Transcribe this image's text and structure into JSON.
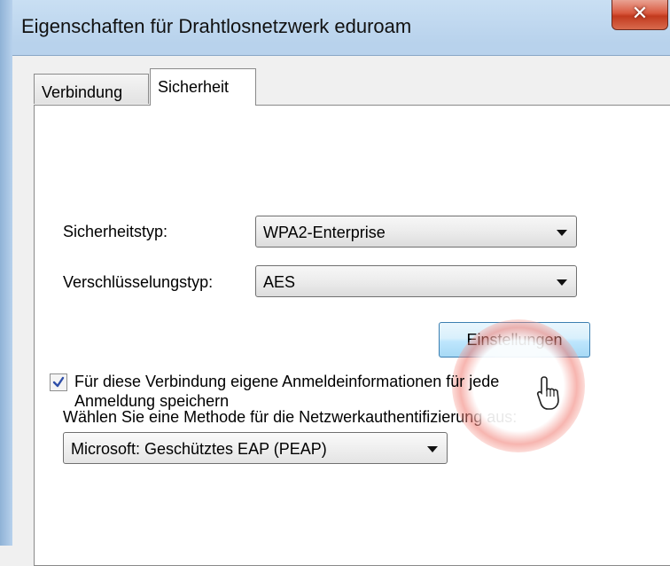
{
  "window": {
    "title": "Eigenschaften für Drahtlosnetzwerk eduroam",
    "close_glyph": "✕"
  },
  "tabs": [
    {
      "label": "Verbindung",
      "active": false
    },
    {
      "label": "Sicherheit",
      "active": true
    }
  ],
  "security": {
    "type_label": "Sicherheitstyp:",
    "type_value": "WPA2-Enterprise",
    "encryption_label": "Verschlüsselungstyp:",
    "encryption_value": "AES"
  },
  "auth": {
    "method_label": "Wählen Sie eine Methode für die Netzwerkauthentifizierung aus:",
    "method_value": "Microsoft: Geschütztes EAP (PEAP)",
    "settings_button": "Einstellungen"
  },
  "credentials": {
    "checked": true,
    "label": "Für diese Verbindung eigene Anmeldeinformationen für jede Anmeldung speichern"
  },
  "colors": {
    "close_button": "#c23a1e",
    "highlight_ring": "#f0786e",
    "button_border": "#3c7fb1"
  }
}
